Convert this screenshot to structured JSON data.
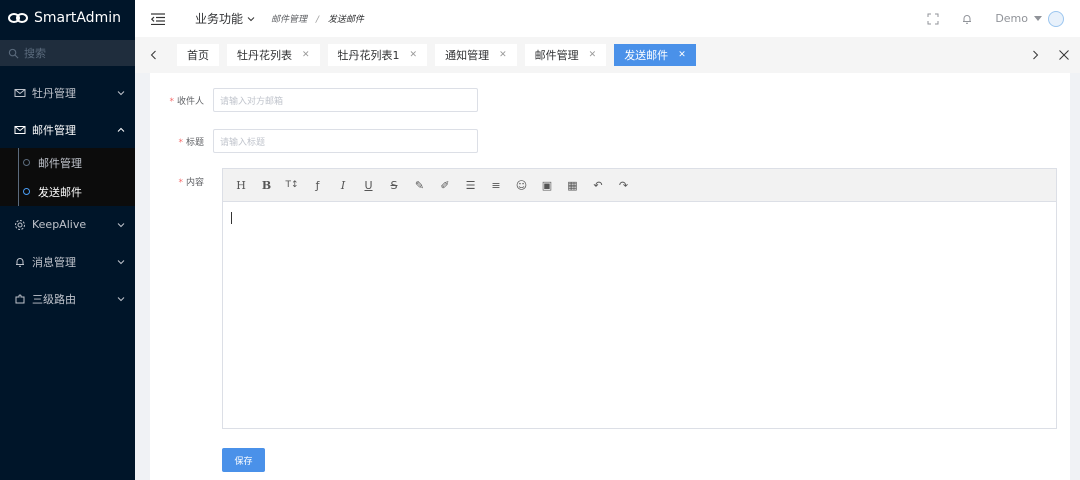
{
  "app": {
    "title": "SmartAdmin"
  },
  "sidebar": {
    "search_placeholder": "搜索",
    "items": [
      {
        "label": "牡丹管理",
        "icon": "mail-icon"
      },
      {
        "label": "邮件管理",
        "icon": "mail-icon",
        "open": true,
        "children": [
          {
            "label": "邮件管理"
          },
          {
            "label": "发送邮件",
            "active": true
          }
        ]
      },
      {
        "label": "KeepAlive",
        "icon": "gear-icon"
      },
      {
        "label": "消息管理",
        "icon": "bell-icon"
      },
      {
        "label": "三级路由",
        "icon": "puzzle-icon"
      }
    ]
  },
  "header": {
    "menu_label": "业务功能",
    "breadcrumb": [
      "邮件管理",
      "发送邮件"
    ],
    "breadcrumb_sep": "/",
    "user": "Demo"
  },
  "tabs": [
    {
      "label": "首页",
      "closable": false
    },
    {
      "label": "牡丹花列表",
      "closable": true
    },
    {
      "label": "牡丹花列表1",
      "closable": true
    },
    {
      "label": "通知管理",
      "closable": true
    },
    {
      "label": "邮件管理",
      "closable": true
    },
    {
      "label": "发送邮件",
      "closable": true,
      "active": true
    }
  ],
  "form": {
    "recipient": {
      "label": "收件人",
      "placeholder": "请输入对方邮箱",
      "required_mark": "*"
    },
    "subject": {
      "label": "标题",
      "placeholder": "请输入标题",
      "required_mark": "*"
    },
    "content": {
      "label": "内容",
      "required_mark": "*"
    },
    "save_label": "保存"
  },
  "editor_toolbar": [
    {
      "name": "heading-icon",
      "glyph": "H"
    },
    {
      "name": "bold-icon",
      "glyph": "B"
    },
    {
      "name": "font-size-icon",
      "glyph": "T↕"
    },
    {
      "name": "font-family-icon",
      "glyph": "ƒ"
    },
    {
      "name": "italic-icon",
      "glyph": "I"
    },
    {
      "name": "underline-icon",
      "glyph": "U"
    },
    {
      "name": "strikethrough-icon",
      "glyph": "S"
    },
    {
      "name": "text-color-icon",
      "glyph": "✎"
    },
    {
      "name": "background-color-icon",
      "glyph": "✐"
    },
    {
      "name": "list-icon",
      "glyph": "☰"
    },
    {
      "name": "align-icon",
      "glyph": "≡"
    },
    {
      "name": "emoji-icon",
      "glyph": "☺"
    },
    {
      "name": "image-icon",
      "glyph": "▣"
    },
    {
      "name": "table-icon",
      "glyph": "▦"
    },
    {
      "name": "undo-icon",
      "glyph": "↶"
    },
    {
      "name": "redo-icon",
      "glyph": "↷"
    }
  ],
  "colors": {
    "sidebar_bg": "#001529",
    "accent": "#4a91e9",
    "required": "#f56c6c"
  }
}
